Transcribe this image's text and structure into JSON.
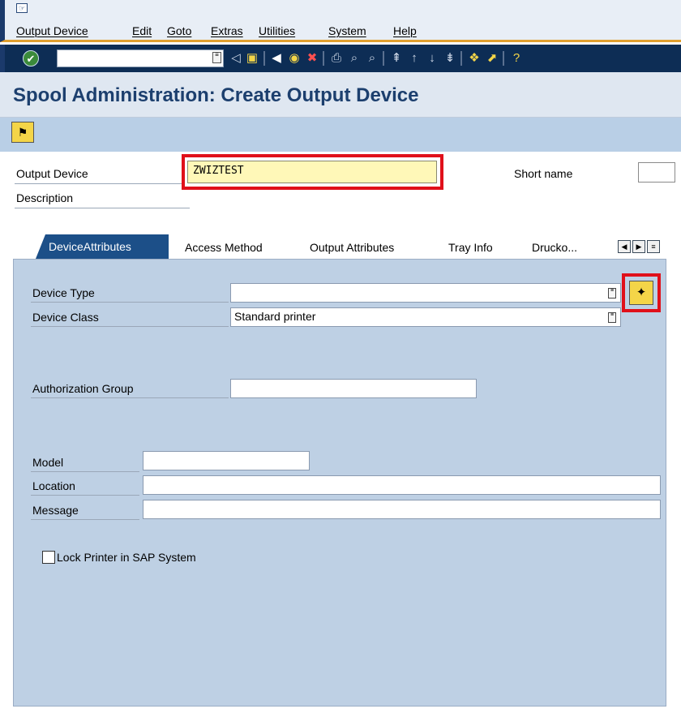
{
  "menu": {
    "items": [
      "Output Device",
      "Edit",
      "Goto",
      "Extras",
      "Utilities",
      "System",
      "Help"
    ]
  },
  "toolbar": {
    "icons": [
      "check-icon",
      "help-icon",
      "back-arrow-icon",
      "save-icon",
      "back-icon",
      "exit-icon",
      "cancel-icon",
      "print-icon",
      "find-icon",
      "find-next-icon",
      "first-page-icon",
      "previous-page-icon",
      "next-page-icon",
      "last-page-icon",
      "create-session-icon",
      "shortcut-icon",
      "help-icon"
    ]
  },
  "title": "Spool Administration: Create Output Device",
  "header": {
    "output_device_label": "Output Device",
    "output_device_value": "ZWIZTEST",
    "short_name_label": "Short name",
    "short_name_value": "",
    "description_label": "Description"
  },
  "tabs": [
    "DeviceAttributes",
    "Access Method",
    "Output Attributes",
    "Tray Info",
    "Drucko..."
  ],
  "panel": {
    "device_type_label": "Device Type",
    "device_type_value": "",
    "device_class_label": "Device Class",
    "device_class_value": "Standard printer",
    "auth_group_label": "Authorization Group",
    "auth_group_value": "",
    "model_label": "Model",
    "model_value": "",
    "location_label": "Location",
    "location_value": "",
    "message_label": "Message",
    "message_value": "",
    "lock_label": "Lock Printer in SAP System"
  },
  "colors": {
    "highlight": "#e0101a",
    "active_tab": "#1c4f88",
    "panel_bg": "#bed0e4",
    "title_text": "#1c3f6e",
    "required_field": "#fff8b8"
  }
}
